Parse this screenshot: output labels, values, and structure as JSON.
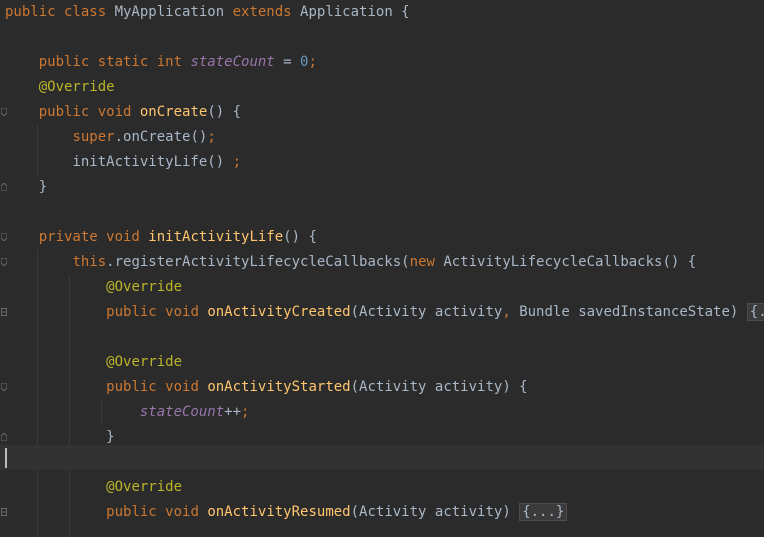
{
  "editor": {
    "lines": [
      {
        "tokens": [
          [
            "kw",
            "public class "
          ],
          [
            "cls",
            "MyApplication "
          ],
          [
            "kw",
            "extends "
          ],
          [
            "cls",
            "Application {"
          ]
        ]
      },
      {
        "tokens": []
      },
      {
        "tokens": [
          [
            "cls",
            "    "
          ],
          [
            "kw",
            "public static int "
          ],
          [
            "field",
            "stateCount"
          ],
          [
            "cls",
            " = "
          ],
          [
            "num",
            "0"
          ],
          [
            "semi",
            ";"
          ]
        ]
      },
      {
        "tokens": [
          [
            "cls",
            "    "
          ],
          [
            "ann",
            "@Override"
          ]
        ]
      },
      {
        "tokens": [
          [
            "cls",
            "    "
          ],
          [
            "kw",
            "public void "
          ],
          [
            "fn",
            "onCreate"
          ],
          [
            "cls",
            "() {"
          ]
        ]
      },
      {
        "tokens": [
          [
            "cls",
            "        "
          ],
          [
            "kw",
            "super"
          ],
          [
            "cls",
            "."
          ],
          [
            "cls",
            "onCreate"
          ],
          [
            "cls",
            "()"
          ],
          [
            "semi",
            ";"
          ]
        ]
      },
      {
        "tokens": [
          [
            "cls",
            "        initActivityLife() "
          ],
          [
            "semi",
            ";"
          ]
        ]
      },
      {
        "tokens": [
          [
            "cls",
            "    }"
          ]
        ]
      },
      {
        "tokens": []
      },
      {
        "tokens": [
          [
            "cls",
            "    "
          ],
          [
            "kw",
            "private void "
          ],
          [
            "fn",
            "initActivityLife"
          ],
          [
            "cls",
            "() {"
          ]
        ]
      },
      {
        "tokens": [
          [
            "cls",
            "        "
          ],
          [
            "kw",
            "this"
          ],
          [
            "cls",
            ".registerActivityLifecycleCallbacks("
          ],
          [
            "kw",
            "new "
          ],
          [
            "cls",
            "ActivityLifecycleCallbacks() {"
          ]
        ]
      },
      {
        "tokens": [
          [
            "cls",
            "            "
          ],
          [
            "ann",
            "@Override"
          ]
        ]
      },
      {
        "tokens": [
          [
            "cls",
            "            "
          ],
          [
            "kw",
            "public void "
          ],
          [
            "fn",
            "onActivityCreated"
          ],
          [
            "cls",
            "(Activity activity"
          ],
          [
            "semi",
            ", "
          ],
          [
            "cls",
            "Bundle savedInstanceState) "
          ],
          [
            "fold",
            "{...}"
          ]
        ]
      },
      {
        "tokens": []
      },
      {
        "tokens": [
          [
            "cls",
            "            "
          ],
          [
            "ann",
            "@Override"
          ]
        ]
      },
      {
        "tokens": [
          [
            "cls",
            "            "
          ],
          [
            "kw",
            "public void "
          ],
          [
            "fn",
            "onActivityStarted"
          ],
          [
            "cls",
            "(Activity activity) {"
          ]
        ]
      },
      {
        "tokens": [
          [
            "cls",
            "                "
          ],
          [
            "field",
            "stateCount"
          ],
          [
            "cls",
            "++"
          ],
          [
            "semi",
            ";"
          ]
        ]
      },
      {
        "tokens": [
          [
            "cls",
            "            }"
          ]
        ]
      },
      {
        "tokens": []
      },
      {
        "tokens": [
          [
            "cls",
            "            "
          ],
          [
            "ann",
            "@Override"
          ]
        ]
      },
      {
        "tokens": [
          [
            "cls",
            "            "
          ],
          [
            "kw",
            "public void "
          ],
          [
            "fn",
            "onActivityResumed"
          ],
          [
            "cls",
            "(Activity activity) "
          ],
          [
            "fold",
            "{...}"
          ]
        ]
      },
      {
        "tokens": []
      }
    ]
  }
}
